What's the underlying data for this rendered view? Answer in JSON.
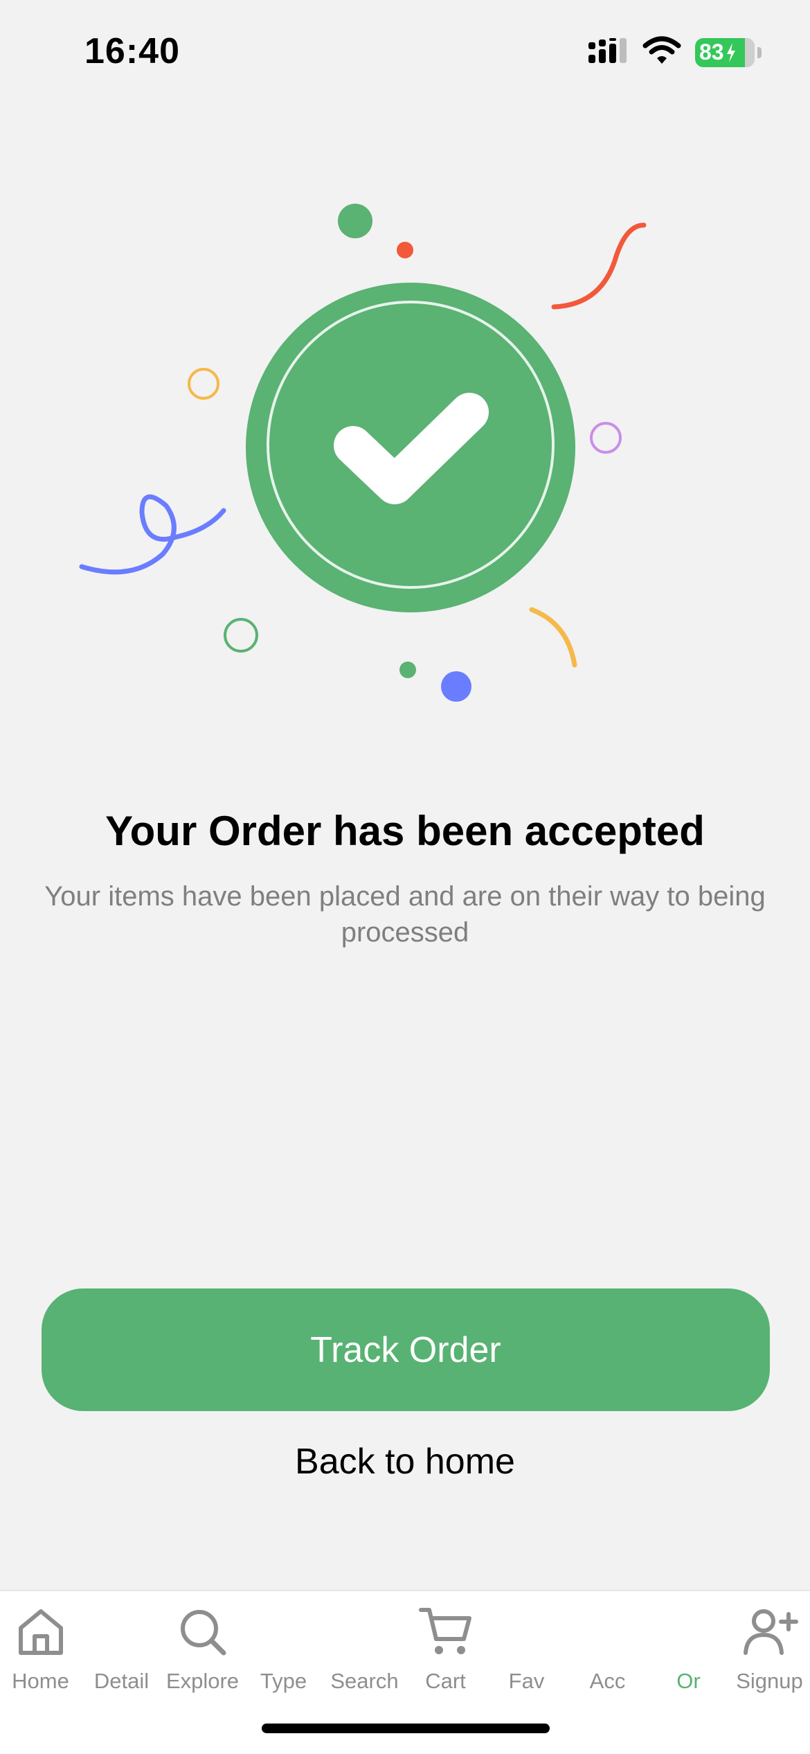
{
  "status_bar": {
    "time": "16:40",
    "battery_level": "83",
    "icons": [
      "cellular-signal-icon",
      "wifi-icon",
      "battery-charging-icon"
    ]
  },
  "illustration": {
    "icon": "checkmark-icon",
    "badge_color": "#5ab273",
    "confetti_colors": [
      "#5ab273",
      "#f2593a",
      "#f5b94b",
      "#c98ee8",
      "#6a7dff"
    ]
  },
  "content": {
    "title": "Your Order has been accepted",
    "subtitle": "Your items have been placed and are on their way to being processed"
  },
  "actions": {
    "primary_label": "Track Order",
    "secondary_label": "Back to home"
  },
  "tab_bar": {
    "active_color": "#58b273",
    "inactive_color": "#8e8e8e",
    "items": [
      {
        "label": "Home",
        "icon": "home-icon",
        "active": false
      },
      {
        "label": "Detail",
        "icon": "",
        "active": false
      },
      {
        "label": "Explore",
        "icon": "search-icon",
        "active": false
      },
      {
        "label": "Type",
        "icon": "",
        "active": false
      },
      {
        "label": "Search",
        "icon": "",
        "active": false
      },
      {
        "label": "Cart",
        "icon": "cart-icon",
        "active": false
      },
      {
        "label": "Fav",
        "icon": "",
        "active": false
      },
      {
        "label": "Acc",
        "icon": "",
        "active": false
      },
      {
        "label": "Or",
        "icon": "",
        "active": true
      },
      {
        "label": "Signup",
        "icon": "add-user-icon",
        "active": false
      }
    ]
  }
}
